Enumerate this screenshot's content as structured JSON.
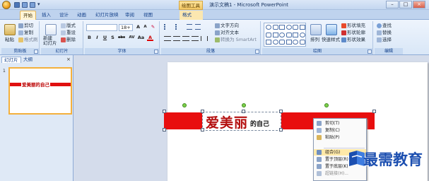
{
  "window": {
    "title": "演示文稿1 - Microsoft PowerPoint",
    "context_tab_title": "绘图工具",
    "controls": [
      "–",
      "□",
      "×"
    ]
  },
  "tabs": [
    {
      "label": "开始",
      "active": true
    },
    {
      "label": "插入"
    },
    {
      "label": "设计"
    },
    {
      "label": "动画"
    },
    {
      "label": "幻灯片放映"
    },
    {
      "label": "审阅"
    },
    {
      "label": "视图"
    },
    {
      "label": "格式",
      "contextual": true
    }
  ],
  "ribbon": {
    "clipboard": {
      "label": "剪贴板",
      "paste": "粘贴",
      "cut": "剪切",
      "copy": "复制",
      "format_painter": "格式刷"
    },
    "slides": {
      "label": "幻灯片",
      "new_slide": "新建\n幻灯片",
      "layout": "版式",
      "reset": "重设",
      "delete": "删除"
    },
    "font": {
      "label": "字体",
      "font_size": "18+",
      "buttons": [
        "B",
        "I",
        "U",
        "S",
        "abc",
        "AV",
        "Aa",
        "A"
      ]
    },
    "paragraph": {
      "label": "段落",
      "text_direction": "文字方向",
      "align_text": "对齐文本",
      "smartart": "转换为 SmartArt"
    },
    "drawing": {
      "label": "绘图",
      "arrange": "排列",
      "quick_styles": "快速样式",
      "shape_fill": "形状填充",
      "shape_outline": "形状轮廓",
      "shape_effects": "形状效果"
    },
    "editing": {
      "label": "编辑",
      "find": "查找",
      "replace": "替换",
      "select": "选择"
    }
  },
  "panel": {
    "tab_slides": "幻灯片",
    "tab_outline": "大纲",
    "close": "×",
    "slide_number": "1",
    "thumb_text": "爱美丽的自己"
  },
  "slide": {
    "big_text": "爱美丽",
    "small_text": "的自己"
  },
  "context_menu": {
    "items": [
      "剪切(T)",
      "复制(C)",
      "粘贴(P)",
      "组合(G)",
      "置于顶层(R)",
      "置于底层(K)",
      "超链接(H)...",
      "另存为图片(S)...",
      "设置形状格式(O)..."
    ]
  },
  "watermark": {
    "text": "最需教育"
  },
  "colors": {
    "accent_red": "#e80e0e",
    "text_red": "#b40f0f",
    "ribbon_blue": "#15428b",
    "watermark_blue": "#1c4fb0"
  }
}
